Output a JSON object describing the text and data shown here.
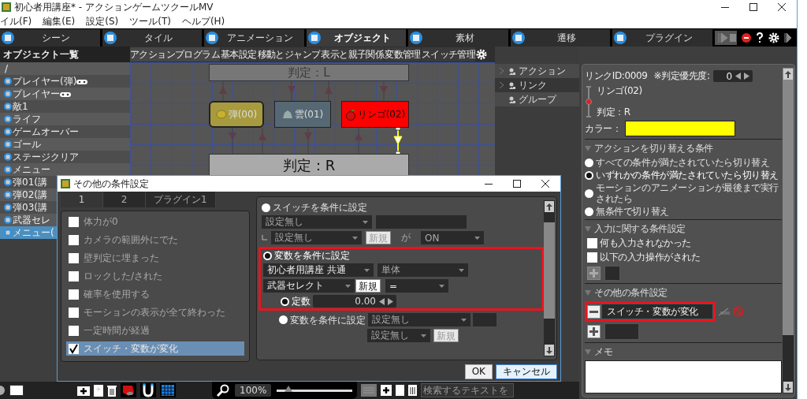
{
  "window": {
    "title": "初心者用講座* - アクションゲームツクールMV"
  },
  "menu": [
    "イル(F)",
    "編集(E)",
    "設定(S)",
    "ツール(T)",
    "ヘルプ(H)"
  ],
  "toolbar_tabs": [
    {
      "label": "シーン",
      "selected": false
    },
    {
      "label": "タイル",
      "selected": false
    },
    {
      "label": "アニメーション",
      "selected": false
    },
    {
      "label": "オブジェクト",
      "selected": true
    },
    {
      "label": "素材",
      "selected": false
    },
    {
      "label": "遷移",
      "selected": false
    },
    {
      "label": "プラグイン",
      "selected": false
    }
  ],
  "object_list": {
    "title": "オブジェクト一覧",
    "tree": [
      {
        "label": "/",
        "selected": false,
        "children": [
          {
            "label": "プレイヤー(弾)",
            "kind": "player",
            "selected": false
          },
          {
            "label": "プレイヤー",
            "kind": "player",
            "selected": false
          },
          {
            "label": "敵1",
            "kind": "object",
            "selected": false
          },
          {
            "label": "ライフ",
            "kind": "object",
            "selected": false
          },
          {
            "label": "ゲームオーバー",
            "kind": "object",
            "selected": false
          },
          {
            "label": "ゴール",
            "kind": "object",
            "selected": false
          },
          {
            "label": "ステージクリア",
            "kind": "object",
            "selected": false
          },
          {
            "label": "メニュー",
            "kind": "object",
            "selected": false
          },
          {
            "label": "弾01(講",
            "kind": "object",
            "selected": false
          },
          {
            "label": "弾02(講",
            "kind": "object",
            "selected": false
          },
          {
            "label": "弾03(講",
            "kind": "object",
            "selected": false
          },
          {
            "label": "武器セレ",
            "kind": "object",
            "selected": false
          },
          {
            "label": "メニュー(",
            "kind": "object",
            "selected": true
          }
        ]
      }
    ]
  },
  "editor_tabs": [
    {
      "label": "アクションプログラム",
      "selected": true
    },
    {
      "label": "基本設定",
      "selected": false
    },
    {
      "label": "移動とジャンプ",
      "selected": false
    },
    {
      "label": "表示と親子関係",
      "selected": false
    },
    {
      "label": "変数管理",
      "selected": false
    },
    {
      "label": "スイッチ管理",
      "selected": false
    }
  ],
  "canvas": {
    "nodes": [
      {
        "kind": "judge",
        "label": "判定：L"
      },
      {
        "kind": "ball",
        "label": "弾(00)",
        "color": "#a89a3e"
      },
      {
        "kind": "cloud",
        "label": "雲(01)",
        "color": "#566873"
      },
      {
        "kind": "apple",
        "label": "リンゴ(02)",
        "color": "#ff0000"
      },
      {
        "kind": "judge",
        "label": "判定：R"
      }
    ]
  },
  "palette": [
    {
      "label": "アクション",
      "expandable": true,
      "selected": false
    },
    {
      "label": "リンク",
      "expandable": true,
      "selected": true
    },
    {
      "label": "グループ",
      "expandable": false,
      "selected": false
    }
  ],
  "link_panel": {
    "link_id": "リンクID:0009",
    "priority_label": "※判定優先度:",
    "priority": "0",
    "from": "リンゴ(02)",
    "to": "判定：R",
    "color_label": "カラー：",
    "color": "#ffff00",
    "switch_conditions": {
      "title": "アクションを切り替える条件",
      "options": [
        {
          "label": "すべての条件が満たされていたら切り替え",
          "selected": false
        },
        {
          "label": "いずれかの条件が満たされていたら切り替え",
          "selected": true
        },
        {
          "label": "モーションのアニメーションが最後まで実行されたら",
          "selected": false
        },
        {
          "label": "無条件で切り替え",
          "selected": false
        }
      ]
    },
    "input_conditions": {
      "title": "入力に関する条件設定",
      "options": [
        {
          "label": "何も入力されなかった",
          "checked": false
        },
        {
          "label": "以下の入力操作がされた",
          "checked": false
        }
      ]
    },
    "other_conditions": {
      "title": "その他の条件設定",
      "items": [
        {
          "label": "スイッチ・変数が変化",
          "highlighted": true
        }
      ]
    },
    "memo": {
      "title": "メモ"
    }
  },
  "dialog": {
    "title": "その他の条件設定",
    "tabs": [
      {
        "label": "1",
        "selected": true
      },
      {
        "label": "2",
        "selected": false
      },
      {
        "label": "プラグイン1",
        "selected": false
      }
    ],
    "conditions": [
      {
        "label": "体力が0",
        "checked": false
      },
      {
        "label": "カメラの範囲外にでた",
        "checked": false
      },
      {
        "label": "壁判定に埋まった",
        "checked": false
      },
      {
        "label": "ロックした/された",
        "checked": false
      },
      {
        "label": "確率を使用する",
        "checked": false
      },
      {
        "label": "モーションの表示が全て終わった",
        "checked": false
      },
      {
        "label": "一定時間が経過",
        "checked": false
      },
      {
        "label": "スイッチ・変数が変化",
        "checked": true
      }
    ],
    "switch_condition": {
      "label": "スイッチを条件に設定",
      "selected": false,
      "switch": "設定無し",
      "sub_switch": "設定無し",
      "new_button": {
        "label": "新規",
        "disabled": true
      },
      "connector": "が",
      "state": "ON"
    },
    "variable_condition": {
      "label": "変数を条件に設定",
      "selected": true,
      "highlighted": true,
      "scope": "初心者用講座 共通",
      "target": "単体",
      "variable": "武器セレクト",
      "new_button": {
        "label": "新規",
        "disabled": false
      },
      "operator": "=",
      "constant": {
        "label": "定数",
        "selected": true,
        "value": "0.00"
      },
      "variable_option": {
        "label": "変数を条件に設定",
        "selected": false,
        "scope": "設定無し",
        "variable": "設定無し",
        "new_button": {
          "label": "新規",
          "disabled": true
        }
      }
    },
    "buttons": [
      "OK",
      "キャンセル"
    ]
  },
  "bottom_bar": {
    "zoom": {
      "value": "100%",
      "level": 0.15
    },
    "search": {
      "placeholder": "検索するテキストを"
    }
  }
}
